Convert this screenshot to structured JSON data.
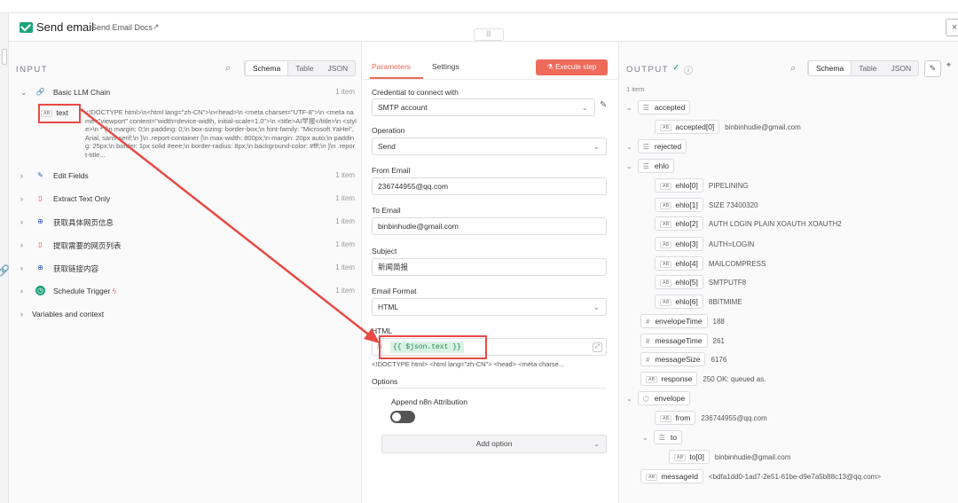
{
  "header": {
    "title": "Send email",
    "docs_label": "Send Email Docs",
    "close_label": "×",
    "drag_handle": "|||"
  },
  "input_panel": {
    "title": "INPUT",
    "views": [
      "Schema",
      "Table",
      "JSON"
    ],
    "nodes": [
      {
        "name": "Basic LLM Chain",
        "items": "1 item",
        "icon": "link-icon",
        "expanded": true
      },
      {
        "name": "Edit Fields",
        "items": "1 item",
        "icon": "pencil-icon"
      },
      {
        "name": "Extract Text Only",
        "items": "1 item",
        "icon": "trash-icon"
      },
      {
        "name": "获取具体网页信息",
        "items": "1 item",
        "icon": "globe-icon"
      },
      {
        "name": "提取需要的网页列表",
        "items": "1 item",
        "icon": "trash-icon"
      },
      {
        "name": "获取链接内容",
        "items": "1 item",
        "icon": "globe-icon"
      },
      {
        "name": "Schedule Trigger",
        "items": "1 item",
        "icon": "clock-icon"
      }
    ],
    "text_field": {
      "tag": "AB",
      "name": "text",
      "value": "<!DOCTYPE html>\\n<html lang=\"zh-CN\">\\n<head>\\n  <meta charset=\"UTF-8\">\\n  <meta name=\"viewport\" content=\"width=device-width, initial-scale=1.0\">\\n  <title>AI早报</title>\\n  <style>\\n    * {\\n margin: 0;\\n padding: 0;\\n box-sizing: border-box;\\n font-family: \"Microsoft YaHei\", Arial, sans-serif;\\n }\\n .report-container {\\n max-width: 800px;\\n margin: 20px auto;\\n padding: 25px;\\n border: 1px solid #eee;\\n border-radius: 8px;\\n background-color: #fff;\\n }\\n .report-title..."
    },
    "variables_label": "Variables and context"
  },
  "params_panel": {
    "tabs": [
      "Parameters",
      "Settings"
    ],
    "execute_label": "Execute step",
    "credential_label": "Credential to connect with",
    "credential_value": "SMTP account",
    "operation_label": "Operation",
    "operation_value": "Send",
    "from_label": "From Email",
    "from_value": "236744955@qq.com",
    "to_label": "To Email",
    "to_value": "binbinhudie@gmail.com",
    "subject_label": "Subject",
    "subject_value": "新闻简报",
    "format_label": "Email Format",
    "format_value": "HTML",
    "html_label": "HTML",
    "fx_label": "fx",
    "html_expression": "{{ $json.text }}",
    "html_preview": "<!DOCTYPE html> <html lang=\"zh-CN\"> <head>   <meta charse...",
    "options_label": "Options",
    "append_label": "Append n8n Attribution",
    "add_option_label": "Add option"
  },
  "output_panel": {
    "title": "OUTPUT",
    "item_count": "1 item",
    "views": [
      "Schema",
      "Table",
      "JSON"
    ],
    "tree": {
      "accepted": {
        "key": "accepted",
        "child_key": "accepted[0]",
        "child_value": "binbinhudie@gmail.com"
      },
      "rejected": {
        "key": "rejected"
      },
      "ehlo": {
        "key": "ehlo",
        "children": [
          {
            "key": "ehlo[0]",
            "value": "PIPELINING"
          },
          {
            "key": "ehlo[1]",
            "value": "SIZE 73400320"
          },
          {
            "key": "ehlo[2]",
            "value": "AUTH LOGIN PLAIN XOAUTH XOAUTH2"
          },
          {
            "key": "ehlo[3]",
            "value": "AUTH=LOGIN"
          },
          {
            "key": "ehlo[4]",
            "value": "MAILCOMPRESS"
          },
          {
            "key": "ehlo[5]",
            "value": "SMTPUTF8"
          },
          {
            "key": "ehlo[6]",
            "value": "8BITMIME"
          }
        ]
      },
      "envelopeTime": {
        "key": "envelopeTime",
        "value": "188"
      },
      "messageTime": {
        "key": "messageTime",
        "value": "261"
      },
      "messageSize": {
        "key": "messageSize",
        "value": "6176"
      },
      "response": {
        "key": "response",
        "value": "250 OK: queued as."
      },
      "envelope": {
        "key": "envelope",
        "from_key": "from",
        "from_value": "236744955@qq.com",
        "to_key": "to",
        "to_child_key": "to[0]",
        "to_child_value": "binbinhudie@gmail.com"
      },
      "messageId": {
        "key": "messageId",
        "value": "<bdfa1dd0-1ad7-2e51-61be-d9e7a5b88c13@qq.com>"
      }
    }
  },
  "colors": {
    "accent": "#ee6a5a",
    "green": "#1ca37a",
    "annotation_red": "#e84a44"
  }
}
